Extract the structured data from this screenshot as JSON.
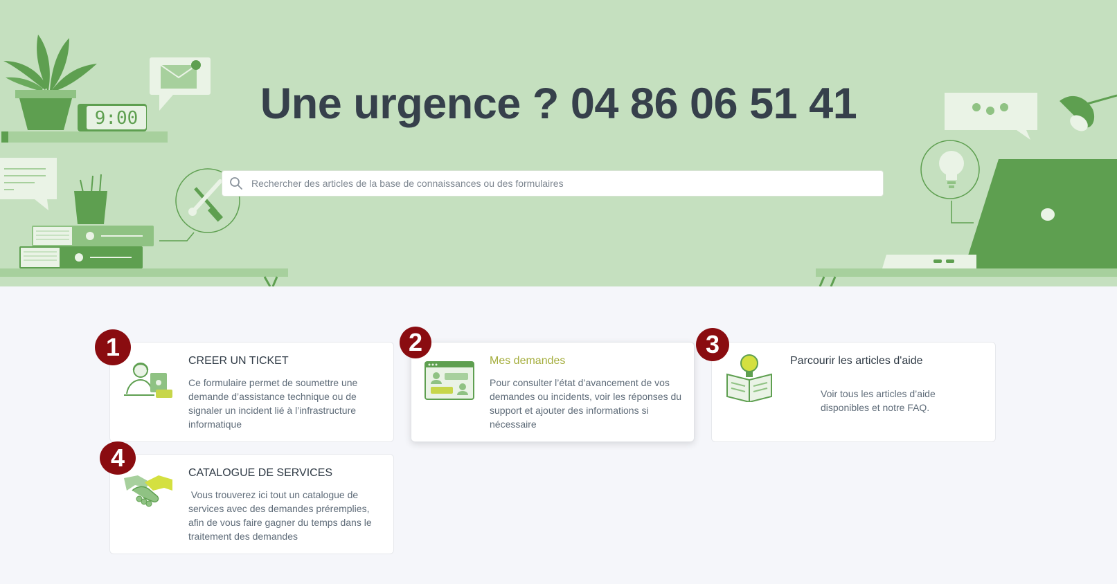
{
  "hero": {
    "title": "Une urgence ? 04 86 06 51 41",
    "clock_text": "9:00",
    "search_placeholder": "Rechercher des articles de la base de connaissances ou des formulaires"
  },
  "colors": {
    "hero_bg": "#c5e0bf",
    "accent_green": "#5e9f50",
    "badge_red": "#8a0c10",
    "active_title": "#a4ad3c"
  },
  "cards": [
    {
      "badge": "1",
      "title": "CREER UN TICKET",
      "description": "Ce formulaire permet de soumettre une demande d’assistance technique ou de signaler un incident lié à l’infrastructure informatique",
      "icon": "support-agent-icon"
    },
    {
      "badge": "2",
      "title": "Mes demandes",
      "description": "Pour consulter l’état d’avancement de vos demandes ou incidents, voir les réponses du support et ajouter des informations si nécessaire",
      "icon": "requests-window-icon"
    },
    {
      "badge": "3",
      "title": "Parcourir les articles d'aide",
      "description": "Voir tous les articles d’aide disponibles et notre FAQ.",
      "icon": "book-lightbulb-icon"
    },
    {
      "badge": "4",
      "title": "CATALOGUE DE SERVICES",
      "description": " Vous trouverez ici tout un catalogue de services avec des demandes préremplies, afin de vous faire gagner du temps dans le traitement des demandes",
      "icon": "handshake-icon"
    }
  ]
}
